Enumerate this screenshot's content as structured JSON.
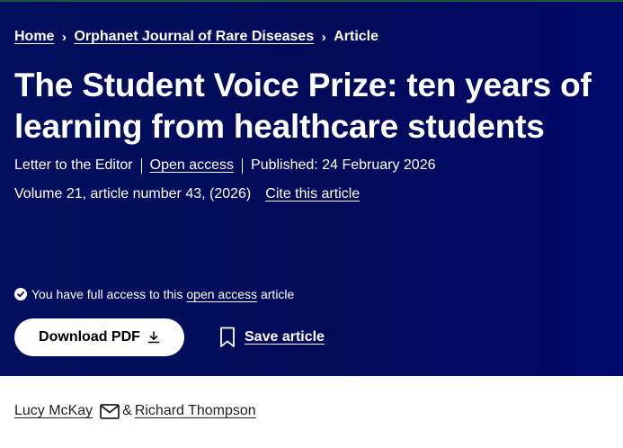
{
  "breadcrumb": {
    "items": [
      "Home",
      "Orphanet Journal of Rare Diseases"
    ],
    "current": "Article"
  },
  "article": {
    "title": "The Student Voice Prize: ten years of learning from healthcare students",
    "type": "Letter to the Editor",
    "access_label": "Open access",
    "published": "Published: 24 February 2026",
    "volume": "Volume 21, article number 43, (2026)",
    "cite_label": "Cite this article"
  },
  "access_notice": {
    "prefix": "You have full access to this",
    "link": "open access",
    "suffix": "article"
  },
  "actions": {
    "download_pdf": "Download PDF",
    "save_article": "Save article"
  },
  "authors": {
    "first": "Lucy McKay",
    "joiner": "&",
    "second": "Richard Thompson"
  },
  "colors": {
    "hero_background": "#020a5a",
    "text_on_hero": "#ffffff"
  },
  "icons": [
    "chevron-right-icon",
    "check-circle-icon",
    "download-icon",
    "bookmark-icon",
    "mail-icon"
  ]
}
